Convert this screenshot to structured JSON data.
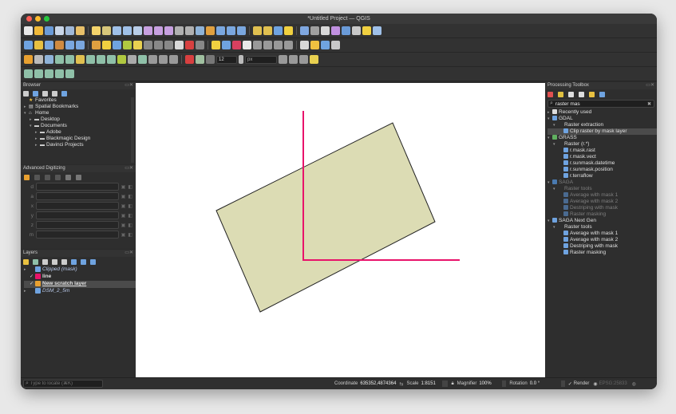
{
  "window": {
    "title": "*Untitled Project — QGIS"
  },
  "browser": {
    "title": "Browser",
    "items": [
      {
        "label": "Favorites",
        "icon": "star-icon"
      },
      {
        "label": "Spatial Bookmarks",
        "icon": "bookmark-icon"
      },
      {
        "label": "Home",
        "icon": "home-icon"
      },
      {
        "label": "Desktop",
        "icon": "folder-icon"
      },
      {
        "label": "Documents",
        "icon": "folder-icon"
      },
      {
        "label": "Adobe",
        "icon": "folder-icon"
      },
      {
        "label": "Blackmagic Design",
        "icon": "folder-icon"
      },
      {
        "label": "Davinci Projects",
        "icon": "folder-icon"
      }
    ]
  },
  "digitizing": {
    "title": "Advanced Digitizing",
    "rows": [
      "d",
      "a",
      "x",
      "y",
      "z",
      "m"
    ]
  },
  "layers": {
    "title": "Layers",
    "items": [
      {
        "label": "Clipped (mask)",
        "style": "italic",
        "checked": false
      },
      {
        "label": "line",
        "style": "bold",
        "checked": true
      },
      {
        "label": "New scratch layer",
        "style": "bold-underline",
        "checked": true
      },
      {
        "label": "DSM_2_5m",
        "style": "italic",
        "checked": false
      }
    ]
  },
  "processing": {
    "title": "Processing Toolbox",
    "search_value": "raster mas",
    "items": [
      {
        "label": "Recently used",
        "indent": 0,
        "tone": "normal"
      },
      {
        "label": "GDAL",
        "indent": 0,
        "tone": "normal"
      },
      {
        "label": "Raster extraction",
        "indent": 1,
        "tone": "normal"
      },
      {
        "label": "Clip raster by mask layer",
        "indent": 2,
        "tone": "selected"
      },
      {
        "label": "GRASS",
        "indent": 0,
        "tone": "normal"
      },
      {
        "label": "Raster (r.*)",
        "indent": 1,
        "tone": "normal"
      },
      {
        "label": "r.mask.rast",
        "indent": 2,
        "tone": "normal"
      },
      {
        "label": "r.mask.vect",
        "indent": 2,
        "tone": "normal"
      },
      {
        "label": "r.sunmask.datetime",
        "indent": 2,
        "tone": "normal"
      },
      {
        "label": "r.sunmask.position",
        "indent": 2,
        "tone": "normal"
      },
      {
        "label": "r.terraflow",
        "indent": 2,
        "tone": "normal"
      },
      {
        "label": "SAGA",
        "indent": 0,
        "tone": "muted"
      },
      {
        "label": "Raster tools",
        "indent": 1,
        "tone": "muted"
      },
      {
        "label": "Average with mask 1",
        "indent": 2,
        "tone": "muted"
      },
      {
        "label": "Average with mask 2",
        "indent": 2,
        "tone": "muted"
      },
      {
        "label": "Destriping with mask",
        "indent": 2,
        "tone": "muted"
      },
      {
        "label": "Raster masking",
        "indent": 2,
        "tone": "muted"
      },
      {
        "label": "SAGA Next Gen",
        "indent": 0,
        "tone": "normal"
      },
      {
        "label": "Raster tools",
        "indent": 1,
        "tone": "normal"
      },
      {
        "label": "Average with mask 1",
        "indent": 2,
        "tone": "normal"
      },
      {
        "label": "Average with mask 2",
        "indent": 2,
        "tone": "normal"
      },
      {
        "label": "Destriping with mask",
        "indent": 2,
        "tone": "normal"
      },
      {
        "label": "Raster masking",
        "indent": 2,
        "tone": "normal"
      }
    ]
  },
  "toolbar": {
    "font_size_value": "12",
    "font_unit": "px"
  },
  "status": {
    "locate_placeholder": "Type to locate (⌘K)",
    "coordinate_label": "Coordinate",
    "coordinate_value": "635352,4874364",
    "scale_label": "Scale",
    "scale_value": "1:8151",
    "magnifier_label": "Magnifier",
    "magnifier_value": "100%",
    "rotation_label": "Rotation",
    "rotation_value": "0.0 °",
    "render_label": "Render",
    "crs_value": "EPSG:25833"
  },
  "colors": {
    "polygon_fill": "#dcdcb4",
    "polygon_stroke": "#222222",
    "line_color": "#e8136a",
    "selected_row": "#4b4b4b"
  }
}
